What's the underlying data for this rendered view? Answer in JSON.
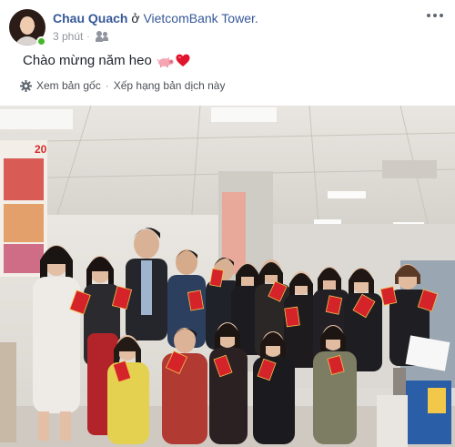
{
  "post": {
    "author": "Chau Quach",
    "at_word": " ở ",
    "location": "VietcomBank Tower.",
    "time": "3 phút",
    "dot": "·",
    "text": "Chào mừng năm heo",
    "emoji_icons": [
      "pig-icon",
      "heart-icon"
    ]
  },
  "translation": {
    "icon": "gear-icon",
    "see_original": "Xem bản gốc",
    "separator": "·",
    "rate": "Xếp hạng bản dịch này"
  },
  "colors": {
    "link": "#365899",
    "muted": "#90949c",
    "online": "#42b72a",
    "red_envelope": "#d5232a"
  },
  "photo": {
    "poster_digits": "20"
  }
}
